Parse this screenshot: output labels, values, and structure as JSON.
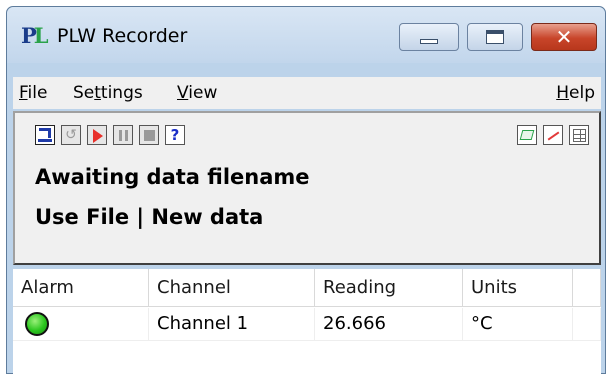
{
  "window": {
    "title": "PLW Recorder",
    "app_icon": "PLW-logo",
    "controls": {
      "minimize": "minimize-icon",
      "maximize": "maximize-icon",
      "close": "close-icon"
    }
  },
  "menu": {
    "file": "File",
    "settings": "Settings",
    "view": "View",
    "help": "Help"
  },
  "toolbar": {
    "left_icons": [
      "load-file-icon",
      "undo-icon",
      "record-icon",
      "pause-icon",
      "stop-icon",
      "help-icon"
    ],
    "right_icons": [
      "graph-icon",
      "trend-icon",
      "spreadsheet-icon"
    ]
  },
  "status": {
    "line1": "Awaiting data filename",
    "line2": "Use File | New data"
  },
  "table": {
    "columns": [
      "Alarm",
      "Channel",
      "Reading",
      "Units"
    ],
    "rows": [
      {
        "alarm": "green",
        "channel": "Channel 1",
        "reading": "26.666",
        "units": "°C"
      }
    ]
  },
  "colors": {
    "alarm_ok": "#2bc61f",
    "record": "#e8302a",
    "accent": "#1e3aa8"
  }
}
